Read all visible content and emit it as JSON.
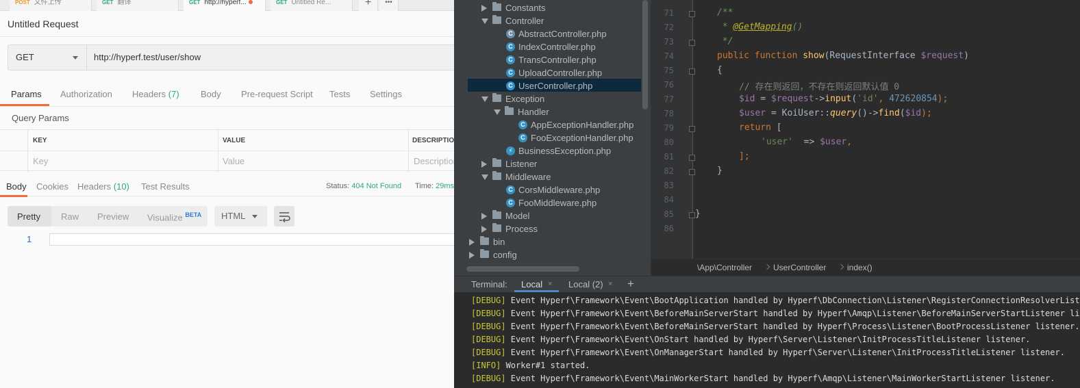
{
  "postman": {
    "tabs": [
      {
        "method": "POST",
        "label": "文件上传"
      },
      {
        "method": "GET",
        "label": "翻译"
      },
      {
        "method": "GET",
        "label": "http://hyperf..."
      },
      {
        "method": "GET",
        "label": "Untitled Re..."
      }
    ],
    "tab_add": "+",
    "tab_more": "•••",
    "request_title": "Untitled Request",
    "method": "GET",
    "url": "http://hyperf.test/user/show",
    "request_tabs": [
      {
        "label": "Params"
      },
      {
        "label": "Authorization"
      },
      {
        "label": "Headers",
        "count": "(7)"
      },
      {
        "label": "Body"
      },
      {
        "label": "Pre-request Script"
      },
      {
        "label": "Tests"
      },
      {
        "label": "Settings"
      }
    ],
    "query_params_title": "Query Params",
    "table_headers": [
      "KEY",
      "VALUE",
      "DESCRIPTION"
    ],
    "table_placeholders": [
      "Key",
      "Value",
      "Description"
    ],
    "response_tabs": [
      {
        "label": "Body"
      },
      {
        "label": "Cookies"
      },
      {
        "label": "Headers",
        "count": "(10)"
      },
      {
        "label": "Test Results"
      }
    ],
    "status_label": "Status:",
    "status_value": "404 Not Found",
    "time_label": "Time:",
    "time_value": "29ms",
    "view_modes": [
      "Pretty",
      "Raw",
      "Preview",
      "Visualize"
    ],
    "beta_badge": "BETA",
    "format": "HTML",
    "line_number": "1"
  },
  "project_tree": [
    {
      "label": "Constants",
      "type": "folder",
      "state": "collapsed"
    },
    {
      "label": "Controller",
      "type": "folder",
      "state": "expanded"
    },
    {
      "label": "AbstractController.php",
      "type": "abstract"
    },
    {
      "label": "IndexController.php",
      "type": "class"
    },
    {
      "label": "TransController.php",
      "type": "class"
    },
    {
      "label": "UploadController.php",
      "type": "class"
    },
    {
      "label": "UserController.php",
      "type": "class",
      "selected": true
    },
    {
      "label": "Exception",
      "type": "folder",
      "state": "expanded"
    },
    {
      "label": "Handler",
      "type": "folder",
      "state": "expanded"
    },
    {
      "label": "AppExceptionHandler.php",
      "type": "class"
    },
    {
      "label": "FooExceptionHandler.php",
      "type": "class"
    },
    {
      "label": "BusinessException.php",
      "type": "exception"
    },
    {
      "label": "Listener",
      "type": "folder",
      "state": "collapsed"
    },
    {
      "label": "Middleware",
      "type": "folder",
      "state": "expanded"
    },
    {
      "label": "CorsMiddleware.php",
      "type": "class"
    },
    {
      "label": "FooMiddleware.php",
      "type": "class"
    },
    {
      "label": "Model",
      "type": "folder",
      "state": "collapsed"
    },
    {
      "label": "Process",
      "type": "folder",
      "state": "collapsed"
    },
    {
      "label": "bin",
      "type": "folder",
      "state": "collapsed"
    },
    {
      "label": "config",
      "type": "folder",
      "state": "collapsed"
    }
  ],
  "editor": {
    "line_numbers": [
      "71",
      "72",
      "73",
      "74",
      "75",
      "76",
      "77",
      "78",
      "79",
      "80",
      "81",
      "82",
      "83",
      "84",
      "85",
      "86"
    ],
    "code": {
      "l71": "/**",
      "l72_star": " * ",
      "l72_ann": "@GetMapping",
      "l72_rest": "()",
      "l73": " */",
      "l74_kw": "public function ",
      "l74_fn": "show",
      "l74_open": "(RequestInterface ",
      "l74_var": "$request",
      "l74_close": ")",
      "l75": "{",
      "l76": "// 存在则返回，不存在则返回默认值 0",
      "l77_var1": "$id",
      "l77_eq": " = ",
      "l77_var2": "$request",
      "l77_arrow": "->",
      "l77_fn": "input",
      "l77_open": "(",
      "l77_str": "'id'",
      "l77_comma": ", ",
      "l77_num": "472620854",
      "l77_close": ");",
      "l78_var1": "$user",
      "l78_eq": " = KoiUser::",
      "l78_fn1": "query",
      "l78_mid": "()->",
      "l78_fn2": "find",
      "l78_open": "(",
      "l78_var2": "$id",
      "l78_close": ");",
      "l79_kw": "return",
      "l79_rest": " [",
      "l80_str": "'user'",
      "l80_arrow": "  => ",
      "l80_var": "$user",
      "l80_comma": ",",
      "l81": "];",
      "l82": "}",
      "l85": "}"
    }
  },
  "breadcrumb": [
    "\\App\\Controller",
    "UserController",
    "index()"
  ],
  "terminal": {
    "label": "Terminal:",
    "tabs": [
      "Local",
      "Local (2)"
    ],
    "close": "×",
    "add": "+",
    "lines": [
      {
        "tag": "[DEBUG]",
        "text": " Event Hyperf\\Framework\\Event\\BootApplication handled by Hyperf\\DbConnection\\Listener\\RegisterConnectionResolverListener listener."
      },
      {
        "tag": "[DEBUG]",
        "text": " Event Hyperf\\Framework\\Event\\BeforeMainServerStart handled by Hyperf\\Amqp\\Listener\\BeforeMainServerStartListener listener."
      },
      {
        "tag": "[DEBUG]",
        "text": " Event Hyperf\\Framework\\Event\\BeforeMainServerStart handled by Hyperf\\Process\\Listener\\BootProcessListener listener."
      },
      {
        "tag": "[DEBUG]",
        "text": " Event Hyperf\\Framework\\Event\\OnStart handled by Hyperf\\Server\\Listener\\InitProcessTitleListener listener."
      },
      {
        "tag": "[DEBUG]",
        "text": " Event Hyperf\\Framework\\Event\\OnManagerStart handled by Hyperf\\Server\\Listener\\InitProcessTitleListener listener."
      },
      {
        "tag": "[INFO]",
        "text": " Worker#1 started."
      },
      {
        "tag": "[DEBUG]",
        "text": " Event Hyperf\\Framework\\Event\\MainWorkerStart handled by Hyperf\\Amqp\\Listener\\MainWorkerStartListener listener."
      }
    ]
  },
  "colors": {
    "postman_accent": "#f26b3a",
    "postman_green": "#2ea87d",
    "ide_bg": "#2b2b2b",
    "ide_panel": "#3c3f41",
    "keyword": "#cc7832",
    "function": "#ffc66d",
    "variable": "#9876aa",
    "string": "#6a8759",
    "number": "#6897bb",
    "log_tag": "#c7c73a"
  }
}
